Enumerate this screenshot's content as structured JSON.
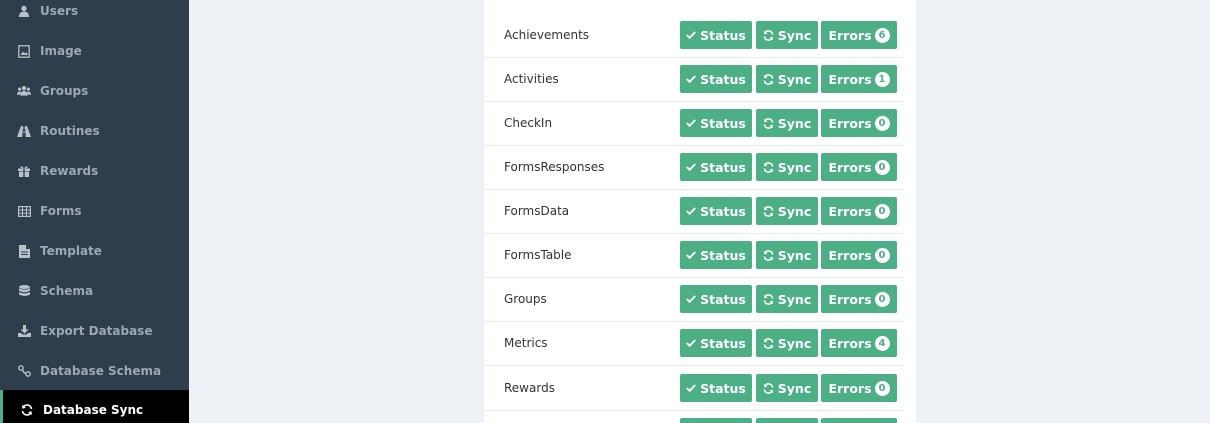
{
  "sidebar": {
    "items": [
      {
        "label": "Users",
        "icon": "user-icon",
        "active": false
      },
      {
        "label": "Image",
        "icon": "image-icon",
        "active": false
      },
      {
        "label": "Groups",
        "icon": "users-group-icon",
        "active": false
      },
      {
        "label": "Routines",
        "icon": "road-icon",
        "active": false
      },
      {
        "label": "Rewards",
        "icon": "gift-icon",
        "active": false
      },
      {
        "label": "Forms",
        "icon": "table-icon",
        "active": false
      },
      {
        "label": "Template",
        "icon": "file-icon",
        "active": false
      },
      {
        "label": "Schema",
        "icon": "database-icon",
        "active": false
      },
      {
        "label": "Export Database",
        "icon": "download-icon",
        "active": false
      },
      {
        "label": "Database Schema",
        "icon": "percent-link-icon",
        "active": false
      },
      {
        "label": "Database Sync",
        "icon": "refresh-icon",
        "active": true
      }
    ]
  },
  "buttons": {
    "status_label": "Status",
    "sync_label": "Sync",
    "errors_label": "Errors"
  },
  "rows": [
    {
      "name": "Achievements",
      "errors": "6"
    },
    {
      "name": "Activities",
      "errors": "1"
    },
    {
      "name": "CheckIn",
      "errors": "0"
    },
    {
      "name": "FormsResponses",
      "errors": "0"
    },
    {
      "name": "FormsData",
      "errors": "0"
    },
    {
      "name": "FormsTable",
      "errors": "0"
    },
    {
      "name": "Groups",
      "errors": "0"
    },
    {
      "name": "Metrics",
      "errors": "4"
    },
    {
      "name": "Rewards",
      "errors": "0"
    }
  ],
  "colors": {
    "accent": "#4caf86",
    "sidebar_bg": "#2f3e4d",
    "active_bg": "#000000"
  }
}
